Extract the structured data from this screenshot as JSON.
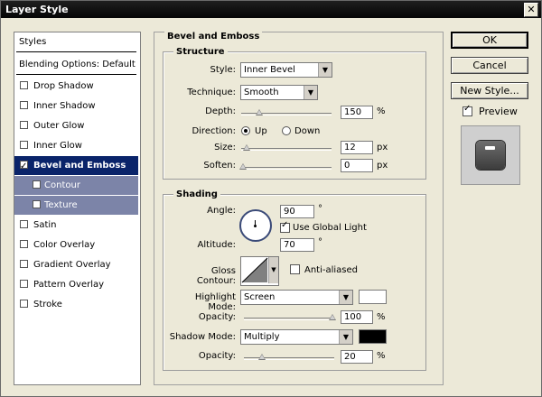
{
  "window": {
    "title": "Layer Style",
    "close_glyph": "✕"
  },
  "styles_list": {
    "header": "Styles",
    "blending": "Blending Options: Default",
    "items": [
      {
        "label": "Drop Shadow",
        "checked": false
      },
      {
        "label": "Inner Shadow",
        "checked": false
      },
      {
        "label": "Outer Glow",
        "checked": false
      },
      {
        "label": "Inner Glow",
        "checked": false
      },
      {
        "label": "Bevel and Emboss",
        "checked": true,
        "selected": true
      },
      {
        "label": "Contour",
        "checked": false,
        "sub": true
      },
      {
        "label": "Texture",
        "checked": false,
        "sub": true
      },
      {
        "label": "Satin",
        "checked": false
      },
      {
        "label": "Color Overlay",
        "checked": false
      },
      {
        "label": "Gradient Overlay",
        "checked": false
      },
      {
        "label": "Pattern Overlay",
        "checked": false
      },
      {
        "label": "Stroke",
        "checked": false
      }
    ]
  },
  "bevel": {
    "title": "Bevel and Emboss",
    "structure": {
      "title": "Structure",
      "style_label": "Style:",
      "style_value": "Inner Bevel",
      "technique_label": "Technique:",
      "technique_value": "Smooth",
      "depth_label": "Depth:",
      "depth_value": "150",
      "depth_unit": "%",
      "direction_label": "Direction:",
      "up_label": "Up",
      "down_label": "Down",
      "direction_selected": "Up",
      "size_label": "Size:",
      "size_value": "12",
      "size_unit": "px",
      "soften_label": "Soften:",
      "soften_value": "0",
      "soften_unit": "px"
    },
    "shading": {
      "title": "Shading",
      "angle_label": "Angle:",
      "angle_value": "90",
      "angle_unit": "°",
      "global_light_label": "Use Global Light",
      "global_light_checked": true,
      "altitude_label": "Altitude:",
      "altitude_value": "70",
      "altitude_unit": "°",
      "gloss_label": "Gloss Contour:",
      "anti_aliased_label": "Anti-aliased",
      "anti_aliased_checked": false,
      "highlight_label": "Highlight Mode:",
      "highlight_value": "Screen",
      "highlight_color": "#ffffff",
      "hl_opacity_label": "Opacity:",
      "hl_opacity_value": "100",
      "hl_opacity_unit": "%",
      "shadow_label": "Shadow Mode:",
      "shadow_value": "Multiply",
      "shadow_color": "#000000",
      "sh_opacity_label": "Opacity:",
      "sh_opacity_value": "20",
      "sh_opacity_unit": "%"
    }
  },
  "buttons": {
    "ok": "OK",
    "cancel": "Cancel",
    "new_style": "New Style..."
  },
  "preview": {
    "label": "Preview",
    "checked": true
  }
}
